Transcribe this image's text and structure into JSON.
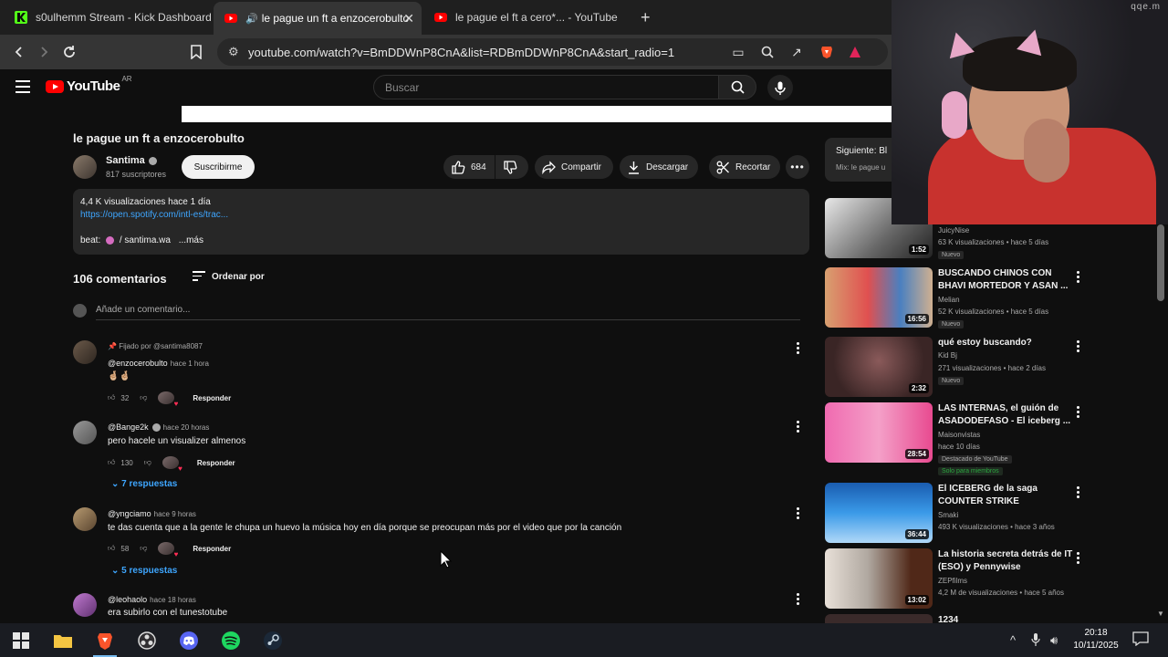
{
  "browser": {
    "tabs": [
      {
        "title": "s0ulhemm Stream - Kick Dashboard",
        "icon": "kick-icon"
      },
      {
        "title": "le pague un ft a enzocerobulto",
        "icon": "youtube-icon"
      },
      {
        "title": "le pague el ft a cero*... - YouTube",
        "icon": "youtube-icon"
      }
    ],
    "url": "youtube.com/watch?v=BmDDWnP8CnA&list=RDBmDDWnP8CnA&start_radio=1"
  },
  "youtube": {
    "region": "AR",
    "search_placeholder": "Buscar",
    "video": {
      "title": "le pague un ft a enzocerobulto",
      "channel": "Santima",
      "subscribers": "817 suscriptores",
      "subscribe_label": "Suscribirme",
      "likes": "684",
      "share_label": "Compartir",
      "download_label": "Descargar",
      "clip_label": "Recortar"
    },
    "description": {
      "stats": "4,4 K visualizaciones  hace 1 día",
      "link": "https://open.spotify.com/intl-es/trac...",
      "beat_prefix": "beat:",
      "beat_text": "/ santima.wa",
      "more": "...más"
    },
    "comments": {
      "count": "106 comentarios",
      "sort_label": "Ordenar por",
      "add_placeholder": "Añade un comentario...",
      "pinned_label": "Fijado por @santima8087",
      "reply_label": "Responder",
      "items": [
        {
          "author": "@enzocerobulto",
          "time": "hace 1 hora",
          "text": "🤞🏼🤞🏼",
          "likes": "32",
          "replies": ""
        },
        {
          "author": "@Bange2k",
          "time": "hace 20 horas",
          "text": "pero hacele un visualizer almenos",
          "likes": "130",
          "replies": "7 respuestas"
        },
        {
          "author": "@yngciamo",
          "time": "hace 9 horas",
          "text": "te das cuenta que a la gente le chupa un huevo la música hoy en día porque se preocupan más por el video que por la canción",
          "likes": "58",
          "replies": "5 respuestas"
        },
        {
          "author": "@leohaolo",
          "time": "hace 18 horas",
          "text": "era subirlo con el tunestotube",
          "likes": "",
          "replies": ""
        }
      ]
    },
    "next": {
      "label": "Siguiente: Bl",
      "sub": "Mix: le pague u"
    },
    "recommendations": [
      {
        "title": "",
        "channel": "JuicyNise",
        "meta": "63 K visualizaciones  • hace 5 días",
        "duration": "1:52",
        "badge": "Nuevo"
      },
      {
        "title": "BUSCANDO CHINOS CON BHAVI MORTEDOR Y ASAN ...",
        "channel": "Melian",
        "meta": "52 K visualizaciones  • hace 5 días",
        "duration": "16:56",
        "badge": "Nuevo"
      },
      {
        "title": "qué estoy buscando?",
        "channel": "Kid Bj",
        "meta": "271 visualizaciones  • hace 2 días",
        "duration": "2:32",
        "badge": "Nuevo"
      },
      {
        "title": "LAS INTERNAS, el guión de ASADODEFASO - El iceberg ...",
        "channel": "Maisonvistas",
        "meta": "hace 10 días",
        "duration": "28:54",
        "badge": "Destacado de YouTube",
        "members": "Solo para miembros"
      },
      {
        "title": "El ICEBERG de la saga COUNTER STRIKE",
        "channel": "Smaki",
        "meta": "493 K visualizaciones  • hace 3 años",
        "duration": "36:44"
      },
      {
        "title": "La historia secreta detrás de IT (ESO) y Pennywise",
        "channel": "ZEPfilms",
        "meta": "4,2 M de visualizaciones  • hace 5 años",
        "duration": "13:02"
      },
      {
        "title": "1234",
        "channel": "",
        "meta": "",
        "duration": ""
      }
    ]
  },
  "webcam": {
    "watermark": "qqe.m"
  },
  "taskbar": {
    "time": "20:18",
    "date": "10/11/2025"
  },
  "colors": {
    "accent_red": "#ff0000",
    "link_blue": "#3ea6ff",
    "background": "#0f0f0f"
  }
}
